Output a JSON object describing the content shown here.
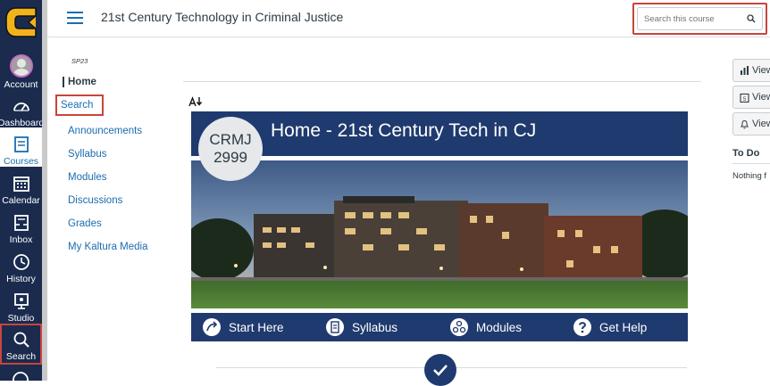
{
  "global_nav": {
    "items": [
      {
        "label": "Account",
        "icon": "account-avatar"
      },
      {
        "label": "Dashboard",
        "icon": "dashboard-icon"
      },
      {
        "label": "Courses",
        "icon": "courses-icon"
      },
      {
        "label": "Calendar",
        "icon": "calendar-icon"
      },
      {
        "label": "Inbox",
        "icon": "inbox-icon"
      },
      {
        "label": "History",
        "icon": "history-icon"
      },
      {
        "label": "Studio",
        "icon": "studio-icon"
      },
      {
        "label": "Search",
        "icon": "search-icon"
      }
    ],
    "active": "Courses",
    "highlighted": "Search",
    "colors": {
      "background": "#1a2b4e",
      "logo": "#f1b31c",
      "active_text": "#1a6db0",
      "highlight_border": "#c8453c"
    }
  },
  "header": {
    "course_title": "21st Century Technology in Criminal Justice",
    "search_placeholder": "Search this course"
  },
  "course_nav": {
    "term": "SP23",
    "items": [
      {
        "label": "Home"
      },
      {
        "label": "Search"
      },
      {
        "label": "Announcements"
      },
      {
        "label": "Syllabus"
      },
      {
        "label": "Modules"
      },
      {
        "label": "Discussions"
      },
      {
        "label": "Grades"
      },
      {
        "label": "My Kaltura Media"
      }
    ]
  },
  "content": {
    "banner_title": "Home - 21st Century Tech in CJ",
    "badge_line1": "CRMJ",
    "badge_line2": "2999",
    "nav_buttons": [
      {
        "label": "Start Here",
        "icon": "start-here-icon"
      },
      {
        "label": "Syllabus",
        "icon": "syllabus-icon"
      },
      {
        "label": "Modules",
        "icon": "modules-icon"
      },
      {
        "label": "Get Help",
        "icon": "help-icon"
      }
    ],
    "colors": {
      "banner": "#1f3a6e"
    }
  },
  "right_sidebar": {
    "buttons": [
      {
        "label": "View",
        "icon": "bar-chart-icon"
      },
      {
        "label": "View",
        "icon": "calendar-small-icon"
      },
      {
        "label": "View",
        "icon": "bell-icon"
      }
    ],
    "todo_title": "To Do",
    "todo_empty": "Nothing f"
  }
}
